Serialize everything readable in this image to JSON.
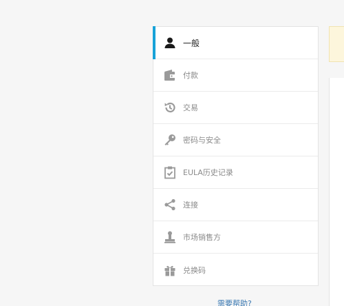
{
  "menu": {
    "items": [
      {
        "label": "一般",
        "icon": "user-icon",
        "active": true
      },
      {
        "label": "付款",
        "icon": "wallet-icon",
        "active": false
      },
      {
        "label": "交易",
        "icon": "history-icon",
        "active": false
      },
      {
        "label": "密码与安全",
        "icon": "key-icon",
        "active": false
      },
      {
        "label": "EULA历史记录",
        "icon": "clipboard-check-icon",
        "active": false
      },
      {
        "label": "连接",
        "icon": "share-icon",
        "active": false
      },
      {
        "label": "市场销售方",
        "icon": "stamp-icon",
        "active": false
      },
      {
        "label": "兑换码",
        "icon": "gift-icon",
        "active": false
      }
    ]
  },
  "help": {
    "link_label": "需要帮助?"
  },
  "colors": {
    "accent": "#17a2d8",
    "notice_bg": "#fdf6dc",
    "link": "#3b79b3"
  }
}
